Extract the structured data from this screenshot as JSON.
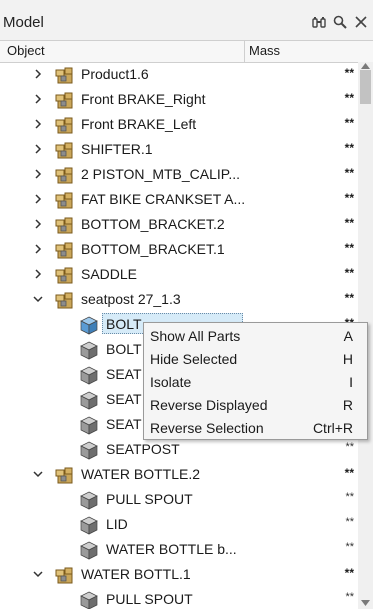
{
  "panel": {
    "title": "Model"
  },
  "columns": {
    "object": "Object",
    "mass": "Mass"
  },
  "rows": [
    {
      "label": "Product1.6",
      "mass": "**"
    },
    {
      "label": "Front BRAKE_Right",
      "mass": "**"
    },
    {
      "label": "Front BRAKE_Left",
      "mass": "**"
    },
    {
      "label": "SHIFTER.1",
      "mass": "**"
    },
    {
      "label": "2 PISTON_MTB_CALIP...",
      "mass": "**"
    },
    {
      "label": "FAT BIKE CRANKSET A...",
      "mass": "**"
    },
    {
      "label": "BOTTOM_BRACKET.2",
      "mass": "**"
    },
    {
      "label": "BOTTOM_BRACKET.1",
      "mass": "**"
    },
    {
      "label": "SADDLE",
      "mass": "**"
    },
    {
      "label": "seatpost 27_1.3",
      "mass": "**"
    },
    {
      "label": "BOLT",
      "mass": "**"
    },
    {
      "label": "BOLT",
      "mass": "**"
    },
    {
      "label": "SEAT",
      "mass": "**"
    },
    {
      "label": "SEAT",
      "mass": "**"
    },
    {
      "label": "SEAT",
      "mass": "**"
    },
    {
      "label": "SEATPOST",
      "mass": "**"
    },
    {
      "label": "WATER BOTTLE.2",
      "mass": "**"
    },
    {
      "label": "PULL SPOUT",
      "mass": "**"
    },
    {
      "label": "LID",
      "mass": "**"
    },
    {
      "label": "WATER BOTTLE b...",
      "mass": "**"
    },
    {
      "label": "WATER BOTTL.1",
      "mass": "**"
    },
    {
      "label": "PULL SPOUT",
      "mass": "**"
    }
  ],
  "context_menu": [
    {
      "label": "Show All Parts",
      "shortcut": "A"
    },
    {
      "label": "Hide Selected",
      "shortcut": "H"
    },
    {
      "label": "Isolate",
      "shortcut": "I"
    },
    {
      "label": "Reverse Displayed",
      "shortcut": "R"
    },
    {
      "label": "Reverse Selection",
      "shortcut": "Ctrl+R"
    }
  ],
  "icons": {
    "assembly": "assembly-icon",
    "part": "part-icon",
    "header": [
      "binoculars-icon",
      "search-icon",
      "close-icon"
    ]
  },
  "colors": {
    "selection": "#d6ebf8",
    "assembly": "#b08a3c",
    "part_cube": "#8a8a8a",
    "part_cube_selected": "#5a9bd4"
  }
}
